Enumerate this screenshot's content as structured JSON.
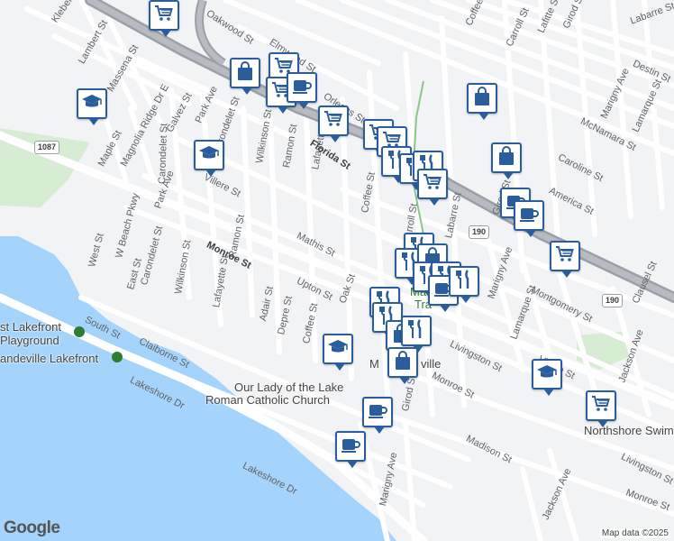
{
  "streets": [
    {
      "text": "Kleber St"
    },
    {
      "text": "Lambert St"
    },
    {
      "text": "Massena St"
    },
    {
      "text": "Oakwood St"
    },
    {
      "text": "Elmwood St"
    },
    {
      "text": "Orleans St"
    },
    {
      "text": "Florida St"
    },
    {
      "text": "Coffee St"
    },
    {
      "text": "Carroll St"
    },
    {
      "text": "Girod St"
    },
    {
      "text": "Lafitte St"
    },
    {
      "text": "Labarre St"
    },
    {
      "text": "Destin St"
    },
    {
      "text": "Marigny Ave"
    },
    {
      "text": "McNamara St"
    },
    {
      "text": "Caroline St"
    },
    {
      "text": "Lamarque St"
    },
    {
      "text": "America St"
    },
    {
      "text": "Maple St"
    },
    {
      "text": "Magnolia Ridge Dr E"
    },
    {
      "text": "Galvez St"
    },
    {
      "text": "Park Ave"
    },
    {
      "text": "Carondelet St"
    },
    {
      "text": "Wilkinson St"
    },
    {
      "text": "Ramon St"
    },
    {
      "text": "Lafayette St"
    },
    {
      "text": "Villere St"
    },
    {
      "text": "Mathis St"
    },
    {
      "text": "Monroe St"
    },
    {
      "text": "West St"
    },
    {
      "text": "W Beach Pkwy"
    },
    {
      "text": "East St"
    },
    {
      "text": "Upton St"
    },
    {
      "text": "Oak St"
    },
    {
      "text": "Adair St"
    },
    {
      "text": "Depre St"
    },
    {
      "text": "South St"
    },
    {
      "text": "Claiborne St"
    },
    {
      "text": "Lakeshore Dr"
    },
    {
      "text": "Livingston St"
    },
    {
      "text": "Montgomery St"
    },
    {
      "text": "Jackson Ave"
    },
    {
      "text": "Clausel St"
    },
    {
      "text": "Madison St"
    },
    {
      "text": "Lakeshore Dr"
    },
    {
      "text": "Jackson Ave"
    },
    {
      "text": "Villere St"
    },
    {
      "text": "Monroe St"
    },
    {
      "text": "Livingston St"
    },
    {
      "text": "Girod St"
    },
    {
      "text": "Marigny Ave"
    }
  ],
  "highway_labels": [
    {
      "text": "Florida St"
    },
    {
      "text": "Monroe St"
    }
  ],
  "shields": [
    {
      "text": "1087"
    },
    {
      "text": "190"
    },
    {
      "text": "190"
    }
  ],
  "places": [
    {
      "text": "st Lakefront",
      "color": "dark"
    },
    {
      "text": "Playground",
      "color": "dark"
    },
    {
      "text": "andeville Lakefront",
      "color": "dark"
    },
    {
      "text": "Our Lady of the Lake",
      "color": "dark"
    },
    {
      "text": "Roman Catholic Church",
      "color": "dark"
    },
    {
      "text": "Ma",
      "color": "green"
    },
    {
      "text": "Tra",
      "color": "green"
    },
    {
      "text": "M",
      "color": "dark"
    },
    {
      "text": "ville",
      "color": "dark"
    },
    {
      "text": "Northshore Swim",
      "color": "dark"
    }
  ],
  "pins": [
    {
      "icon": "cart"
    },
    {
      "icon": "bag"
    },
    {
      "icon": "cart"
    },
    {
      "icon": "cart"
    },
    {
      "icon": "cup"
    },
    {
      "icon": "cart"
    },
    {
      "icon": "school"
    },
    {
      "icon": "bag"
    },
    {
      "icon": "school"
    },
    {
      "icon": "cart"
    },
    {
      "icon": "cart"
    },
    {
      "icon": "fork"
    },
    {
      "icon": "fork"
    },
    {
      "icon": "fork"
    },
    {
      "icon": "cart"
    },
    {
      "icon": "bag"
    },
    {
      "icon": "cup"
    },
    {
      "icon": "cup"
    },
    {
      "icon": "cart"
    },
    {
      "icon": "fork"
    },
    {
      "icon": "fork"
    },
    {
      "icon": "bag"
    },
    {
      "icon": "fork"
    },
    {
      "icon": "fork"
    },
    {
      "icon": "cup"
    },
    {
      "icon": "fork"
    },
    {
      "icon": "fork"
    },
    {
      "icon": "school"
    },
    {
      "icon": "fork"
    },
    {
      "icon": "bag"
    },
    {
      "icon": "fork"
    },
    {
      "icon": "bag"
    },
    {
      "icon": "cup"
    },
    {
      "icon": "school"
    },
    {
      "icon": "cart"
    },
    {
      "icon": "cup"
    }
  ],
  "attribution": {
    "brand": "Google",
    "text": "Map data ©2025"
  },
  "colors": {
    "water": "#a4d4fb",
    "highway": "#9aa0a6",
    "pin_border": "#2a5d9e",
    "park": "#c9e7c8",
    "background": "#f2f3f5"
  }
}
